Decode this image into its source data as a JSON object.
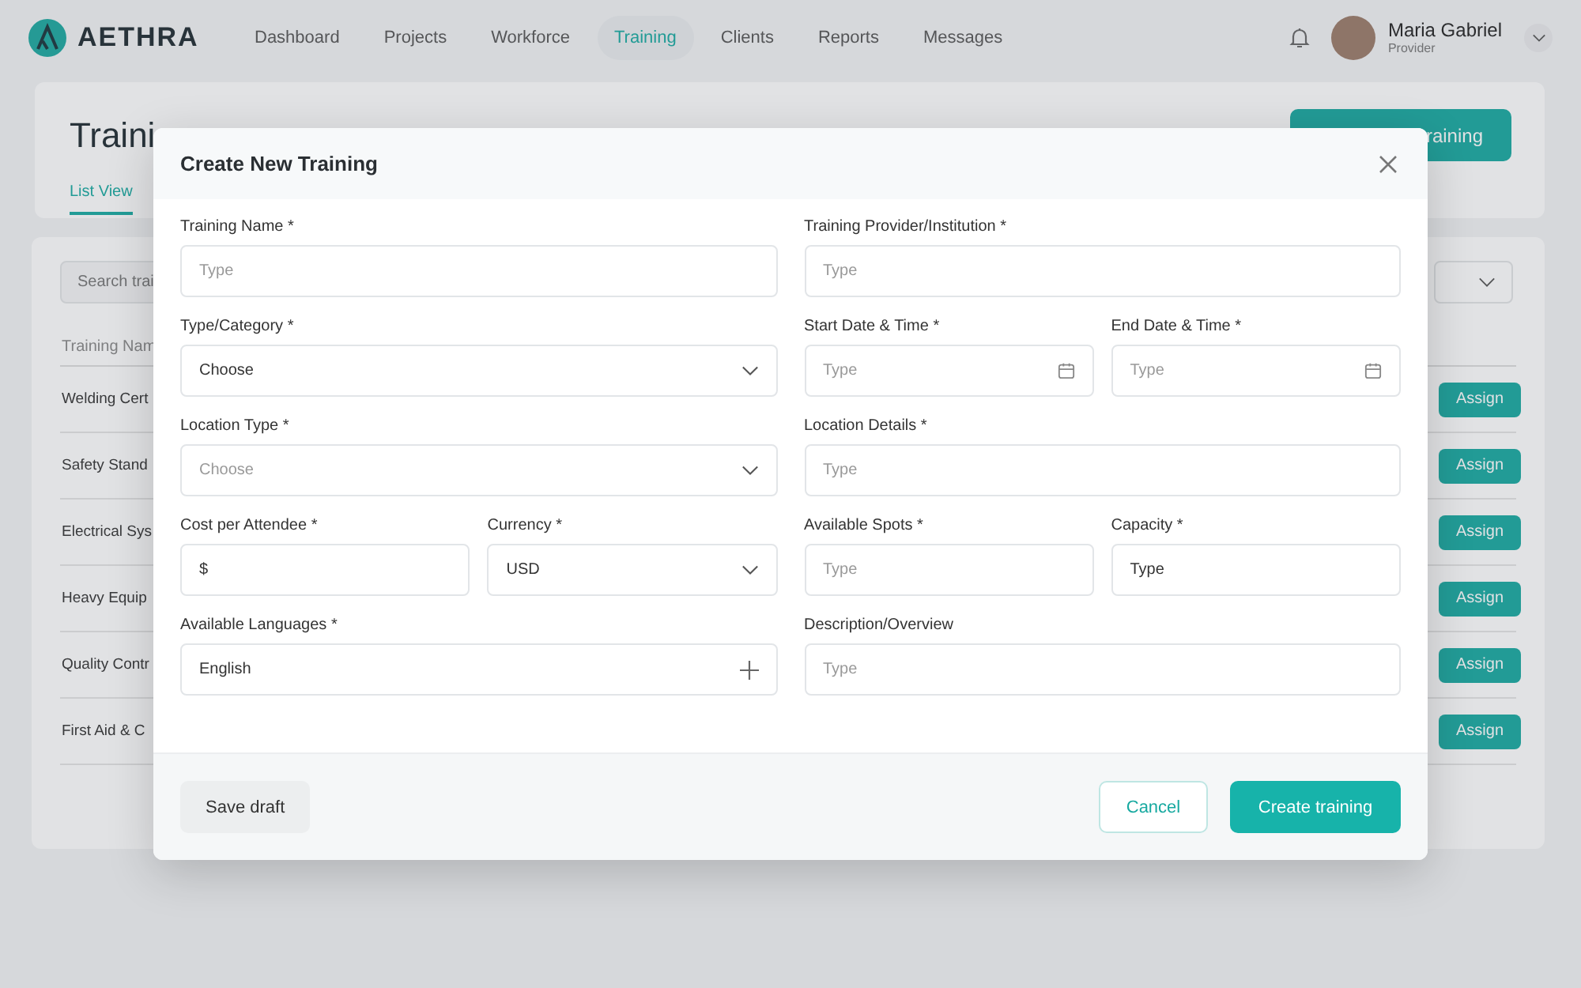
{
  "brand": {
    "name": "AETHRA"
  },
  "nav": [
    {
      "label": "Dashboard",
      "selected": false
    },
    {
      "label": "Projects",
      "selected": false
    },
    {
      "label": "Workforce",
      "selected": false
    },
    {
      "label": "Training",
      "selected": true
    },
    {
      "label": "Clients",
      "selected": false
    },
    {
      "label": "Reports",
      "selected": false
    },
    {
      "label": "Messages",
      "selected": false
    }
  ],
  "user": {
    "name": "Maria Gabriel",
    "role": "Provider"
  },
  "page": {
    "title": "Traini",
    "action_button": "raining",
    "tabs": [
      {
        "label": "List View",
        "selected": true
      }
    ]
  },
  "list": {
    "search_placeholder": "Search trai",
    "column_1": "Training Nam",
    "rows": [
      {
        "name": "Welding Cert",
        "action": "Assign"
      },
      {
        "name": "Safety Stand",
        "action": "Assign"
      },
      {
        "name": "Electrical Sys",
        "action": "Assign"
      },
      {
        "name": "Heavy Equip",
        "action": "Assign"
      },
      {
        "name": "Quality Contr",
        "action": "Assign"
      },
      {
        "name": "First Aid & C",
        "action": "Assign"
      }
    ]
  },
  "dialog": {
    "title": "Create New Training",
    "rows": [
      {
        "left": [
          {
            "kind": "text",
            "label": "Training Name *",
            "placeholder": "Type"
          }
        ],
        "right": [
          {
            "kind": "text",
            "label": "Training Provider/Institution *",
            "placeholder": "Type"
          }
        ]
      },
      {
        "left": [
          {
            "kind": "select",
            "label": "Type/Category *",
            "value": "Choose"
          }
        ],
        "right": [
          {
            "kind": "date",
            "label": "Start Date & Time *",
            "placeholder": "Type"
          },
          {
            "kind": "date",
            "label": "End Date & Time *",
            "placeholder": "Type"
          }
        ]
      },
      {
        "left": [
          {
            "kind": "select",
            "label": "Location Type *",
            "placeholder": "Choose"
          }
        ],
        "right": [
          {
            "kind": "text",
            "label": "Location Details *",
            "placeholder": "Type"
          }
        ]
      },
      {
        "left": [
          {
            "kind": "text",
            "label": "Cost per Attendee *",
            "value": "$"
          },
          {
            "kind": "select",
            "label": "Currency *",
            "value": "USD"
          }
        ],
        "right": [
          {
            "kind": "text",
            "label": "Available Spots *",
            "placeholder": "Type"
          },
          {
            "kind": "text",
            "label": "Capacity *",
            "value": "Type"
          }
        ]
      },
      {
        "left": [
          {
            "kind": "add",
            "label": "Available Languages *",
            "value": "English"
          }
        ],
        "right": [
          {
            "kind": "text",
            "label": "Description/Overview",
            "placeholder": "Type"
          }
        ]
      }
    ],
    "buttons": {
      "draft": "Save draft",
      "cancel": "Cancel",
      "submit": "Create training"
    }
  }
}
